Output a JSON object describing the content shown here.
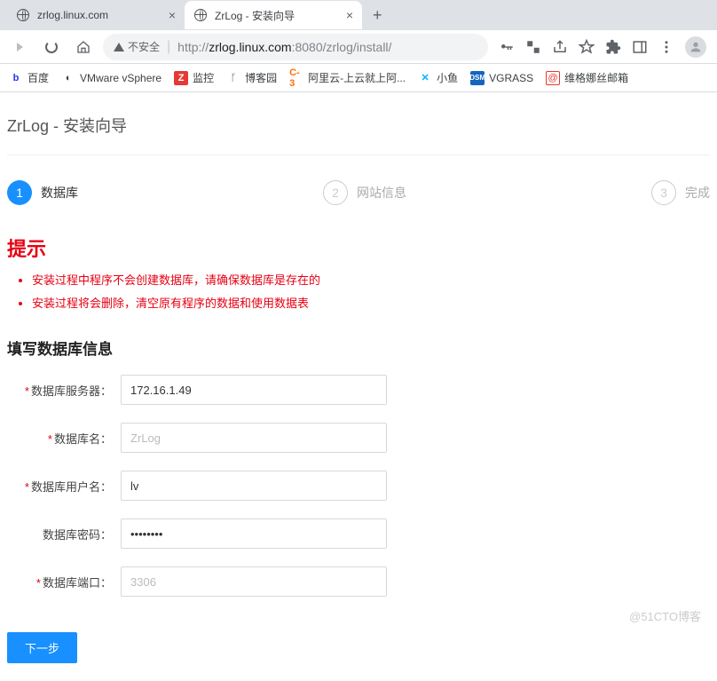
{
  "browser": {
    "tabs": [
      {
        "title": "zrlog.linux.com",
        "favicon": "globe"
      },
      {
        "title": "ZrLog - 安装向导",
        "favicon": "globe"
      }
    ],
    "new_tab_glyph": "+",
    "close_glyph": "×",
    "security_label": "不安全",
    "url_host": "zrlog.linux.com",
    "url_port": ":8080",
    "url_path": "/zrlog/install/",
    "url_prefix": "http://"
  },
  "bookmarks": [
    {
      "icon": "baidu",
      "label": "百度"
    },
    {
      "icon": "vm",
      "label": "VMware vSphere"
    },
    {
      "icon": "z",
      "label": "监控"
    },
    {
      "icon": "cnblog",
      "label": "博客园"
    },
    {
      "icon": "aliyun",
      "label": "阿里云-上云就上阿..."
    },
    {
      "icon": "fish",
      "label": "小鱼"
    },
    {
      "icon": "dsm",
      "label": "VGRASS"
    },
    {
      "icon": "mail",
      "label": "维格娜丝邮箱"
    }
  ],
  "page": {
    "title": "ZrLog - 安装向导",
    "steps": [
      {
        "num": "1",
        "label": "数据库"
      },
      {
        "num": "2",
        "label": "网站信息"
      },
      {
        "num": "3",
        "label": "完成"
      }
    ],
    "hint_title": "提示",
    "hints": [
      "安装过程中程序不会创建数据库，请确保数据库是存在的",
      "安装过程将会删除，清空原有程序的数据和使用数据表"
    ],
    "form_title": "填写数据库信息",
    "form": {
      "server_label": "数据库服务器：",
      "server_value": "172.16.1.49",
      "dbname_label": "数据库名：",
      "dbname_placeholder": "ZrLog",
      "user_label": "数据库用户名：",
      "user_value": "lv",
      "password_label": "数据库密码：",
      "password_value": "••••••••",
      "port_label": "数据库端口：",
      "port_placeholder": "3306"
    },
    "next_button": "下一步"
  },
  "watermark": "@51CTO博客"
}
